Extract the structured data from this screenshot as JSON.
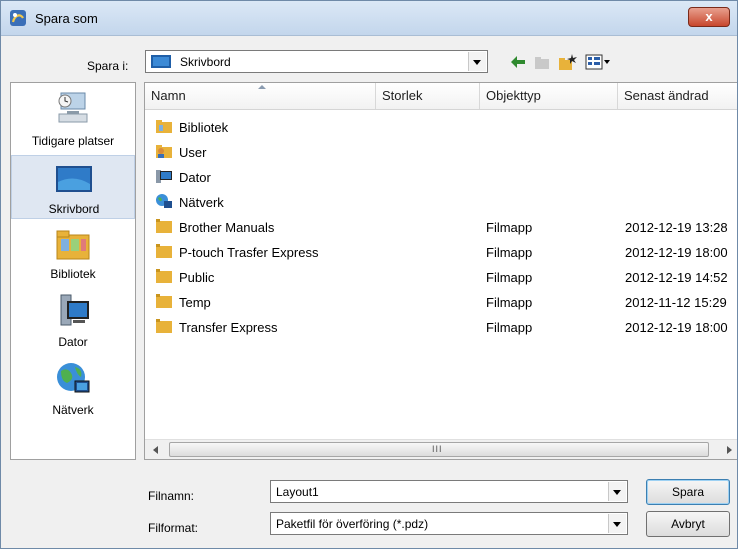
{
  "window": {
    "title": "Spara som",
    "close_label": "x"
  },
  "lookin": {
    "label": "Spara i:",
    "value": "Skrivbord"
  },
  "places": [
    {
      "label": "Tidigare platser"
    },
    {
      "label": "Skrivbord"
    },
    {
      "label": "Bibliotek"
    },
    {
      "label": "Dator"
    },
    {
      "label": "Nätverk"
    }
  ],
  "columns": [
    "Namn",
    "Storlek",
    "Objekttyp",
    "Senast ändrad"
  ],
  "files": [
    {
      "name": "Bibliotek",
      "size": "",
      "type": "",
      "modified": "",
      "icon": "library-icon"
    },
    {
      "name": "User",
      "size": "",
      "type": "",
      "modified": "",
      "icon": "user-folder-icon"
    },
    {
      "name": "Dator",
      "size": "",
      "type": "",
      "modified": "",
      "icon": "computer-icon"
    },
    {
      "name": "Nätverk",
      "size": "",
      "type": "",
      "modified": "",
      "icon": "network-icon"
    },
    {
      "name": "Brother Manuals",
      "size": "",
      "type": "Filmapp",
      "modified": "2012-12-19 13:28",
      "icon": "folder-icon"
    },
    {
      "name": "P-touch Trasfer Express",
      "size": "",
      "type": "Filmapp",
      "modified": "2012-12-19 18:00",
      "icon": "folder-icon"
    },
    {
      "name": "Public",
      "size": "",
      "type": "Filmapp",
      "modified": "2012-12-19 14:52",
      "icon": "folder-icon"
    },
    {
      "name": "Temp",
      "size": "",
      "type": "Filmapp",
      "modified": "2012-11-12 15:29",
      "icon": "folder-icon"
    },
    {
      "name": "Transfer Express",
      "size": "",
      "type": "Filmapp",
      "modified": "2012-12-19 18:00",
      "icon": "folder-icon"
    }
  ],
  "scroll_grip": "III",
  "filename": {
    "label": "Filnamn:",
    "value": "Layout1"
  },
  "filetype": {
    "label": "Filformat:",
    "value": "Paketfil för överföring (*.pdz)"
  },
  "buttons": {
    "save": "Spara",
    "cancel": "Avbryt"
  },
  "colors": {
    "selection": "#dfe7f2",
    "folder": "#e8b23a",
    "titlebar": "#c3d6ec"
  }
}
